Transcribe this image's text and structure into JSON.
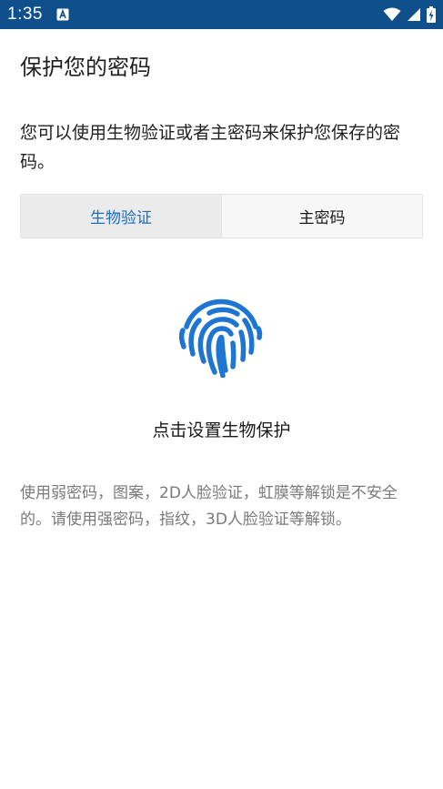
{
  "status_bar": {
    "time": "1:35",
    "icons": [
      "app-notification-icon",
      "wifi-icon",
      "signal-icon",
      "battery-charging-icon"
    ],
    "background_color": "#0e4f8c"
  },
  "page": {
    "title": "保护您的密码",
    "description": "您可以使用生物验证或者主密码来保护您保存的密码。"
  },
  "tabs": [
    {
      "label": "生物验证",
      "selected": true
    },
    {
      "label": "主密码",
      "selected": false
    }
  ],
  "biometric": {
    "icon": "fingerprint-icon",
    "icon_color": "#1e76d2",
    "action_label": "点击设置生物保护"
  },
  "warning": {
    "text": "使用弱密码，图案，2D人脸验证，虹膜等解锁是不安全的。请使用强密码，指纹，3D人脸验证等解锁。"
  },
  "colors": {
    "accent": "#1c6ec4",
    "secondary_text": "#7a7a7a"
  }
}
